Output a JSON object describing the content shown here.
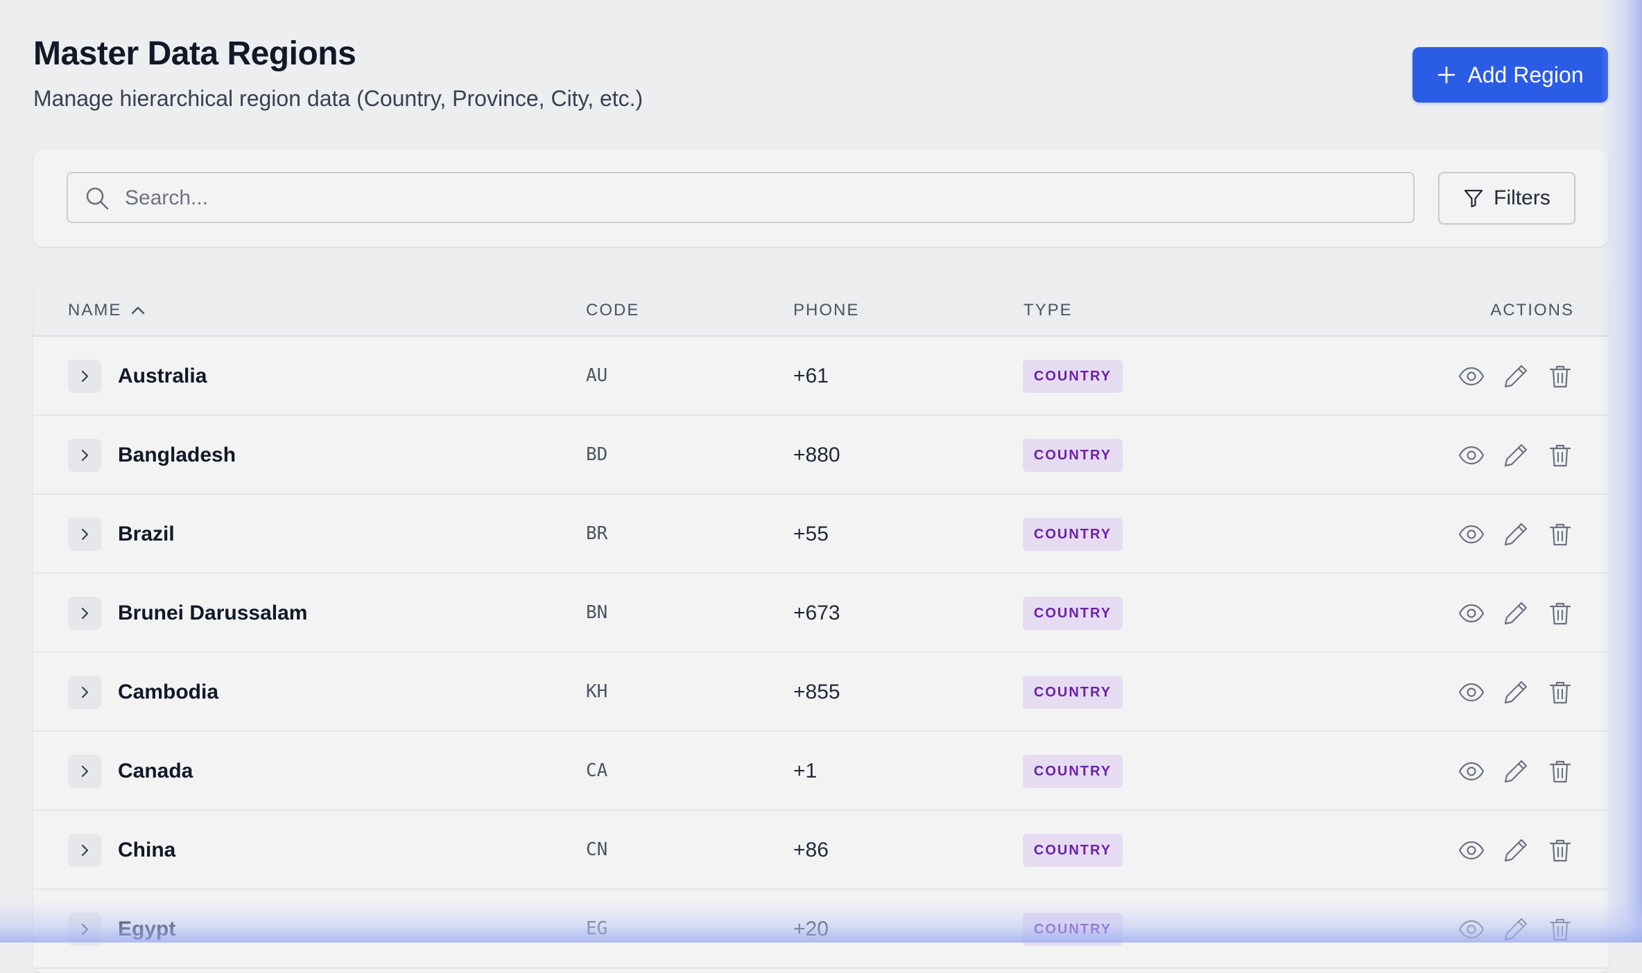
{
  "header": {
    "title": "Master Data Regions",
    "subtitle": "Manage hierarchical region data (Country, Province, City, etc.)",
    "add_label": "Add Region"
  },
  "search": {
    "placeholder": "Search...",
    "value": "",
    "filters_label": "Filters"
  },
  "table": {
    "columns": {
      "name": "NAME",
      "code": "CODE",
      "phone": "PHONE",
      "type": "TYPE",
      "actions": "ACTIONS"
    },
    "sort": {
      "column": "name",
      "direction": "ascending"
    },
    "rows": [
      {
        "name": "Australia",
        "code": "AU",
        "phone": "+61",
        "type": "COUNTRY"
      },
      {
        "name": "Bangladesh",
        "code": "BD",
        "phone": "+880",
        "type": "COUNTRY"
      },
      {
        "name": "Brazil",
        "code": "BR",
        "phone": "+55",
        "type": "COUNTRY"
      },
      {
        "name": "Brunei Darussalam",
        "code": "BN",
        "phone": "+673",
        "type": "COUNTRY"
      },
      {
        "name": "Cambodia",
        "code": "KH",
        "phone": "+855",
        "type": "COUNTRY"
      },
      {
        "name": "Canada",
        "code": "CA",
        "phone": "+1",
        "type": "COUNTRY"
      },
      {
        "name": "China",
        "code": "CN",
        "phone": "+86",
        "type": "COUNTRY"
      },
      {
        "name": "Egypt",
        "code": "EG",
        "phone": "+20",
        "type": "COUNTRY"
      }
    ]
  },
  "icons": {
    "add": "plus-icon",
    "search": "search-icon",
    "filters": "filter-icon",
    "sort": "chevron-up-icon",
    "expand": "chevron-right-icon",
    "view": "eye-icon",
    "edit": "pencil-icon",
    "delete": "trash-icon"
  },
  "colors": {
    "primary": "#2b5ce6",
    "badge_bg": "#e6dcf2",
    "badge_text": "#6b21a8",
    "background": "#edeef0"
  }
}
